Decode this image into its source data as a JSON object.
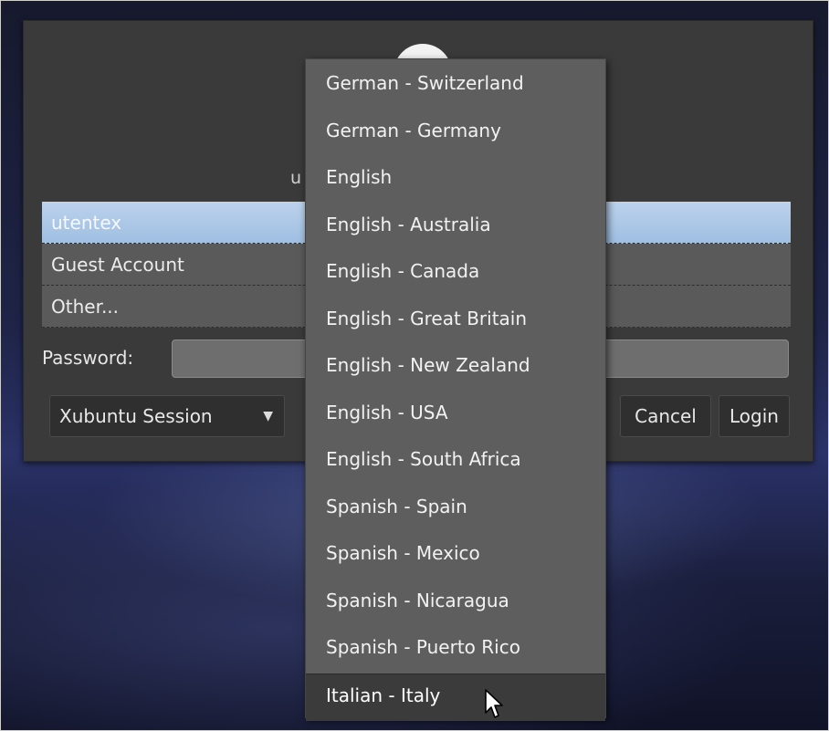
{
  "login": {
    "user_prompt": "u",
    "users": [
      "utentex",
      "Guest Account",
      "Other..."
    ],
    "selected_user": "utentex",
    "password_label": "Password:",
    "password_value": "",
    "session_label": "Xubuntu Session",
    "cancel_label": "Cancel",
    "login_label": "Login"
  },
  "language_menu": {
    "items": [
      "German - Switzerland",
      "German - Germany",
      "English",
      "English - Australia",
      "English - Canada",
      "English - Great Britain",
      "English - New Zealand",
      "English - USA",
      "English - South Africa",
      "Spanish - Spain",
      "Spanish - Mexico",
      "Spanish - Nicaragua",
      "Spanish - Puerto Rico",
      "Italian - Italy"
    ],
    "hovered_item": "Italian - Italy"
  },
  "icons": {
    "avatar": "user-avatar-icon",
    "session_caret": "chevron-down-icon",
    "cursor": "mouse-pointer-icon"
  },
  "colors": {
    "panel_bg": "#3a3a3a",
    "selection_blue": "#a9c6e6",
    "menu_bg": "#5e5e5e",
    "menu_hover_bg": "#3b3b3b"
  }
}
